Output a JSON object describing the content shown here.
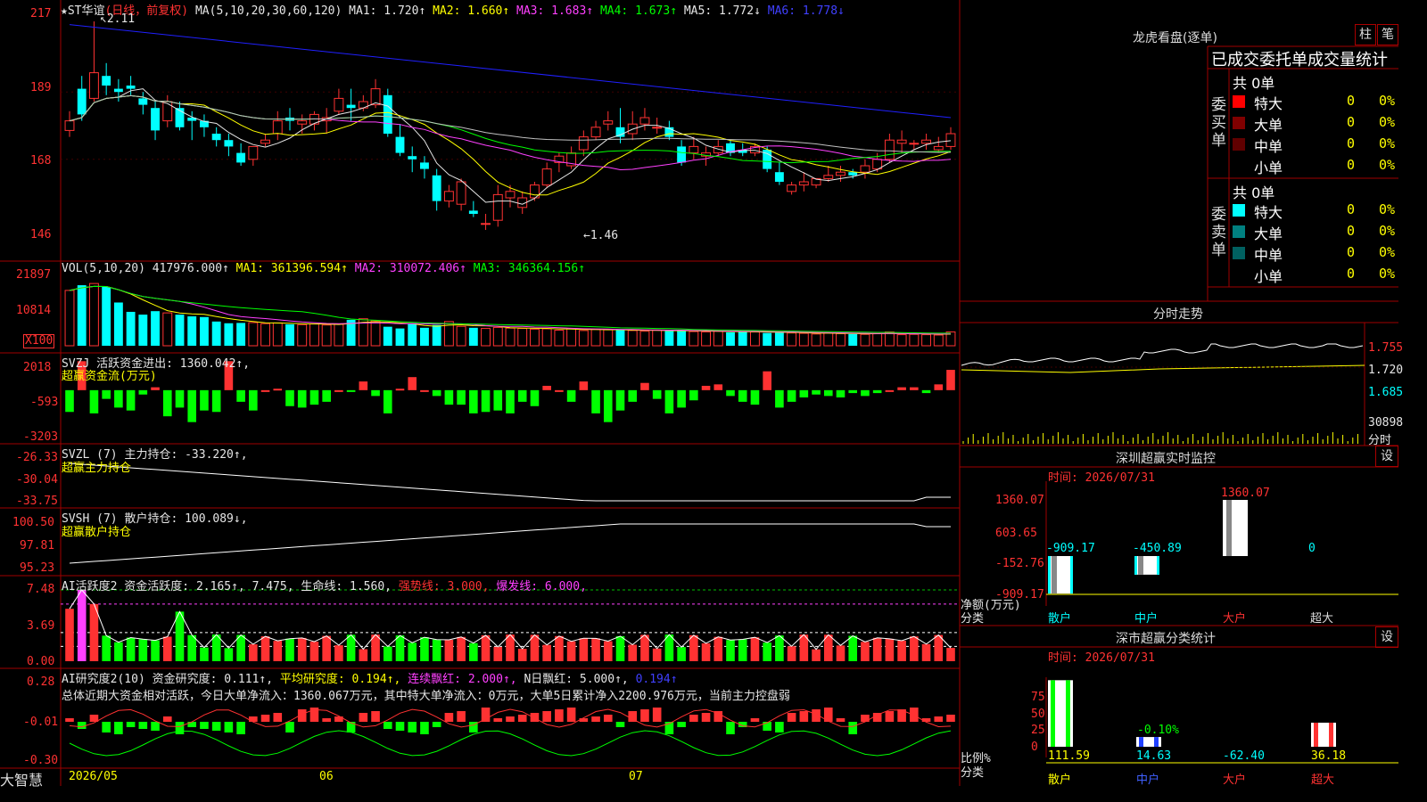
{
  "colors": {
    "up": "#ff3232",
    "down": "#00ffff",
    "grid": "#a00000",
    "ma1": "#e6e6e6",
    "ma2": "#ffff00",
    "ma3": "#ff40ff",
    "ma4": "#00ff00",
    "ma5": "#c0c0c0",
    "ma6": "#2020ff"
  },
  "header": {
    "star": "★ST华谊",
    "period": "(日线，前复权)",
    "ma_label": "MA(5,10,20,30,60,120)",
    "ma1": "MA1: 1.720↑",
    "ma2": "MA2: 1.660↑",
    "ma3": "MA3: 1.683↑",
    "ma4": "MA4: 1.673↑",
    "ma5": "MA5: 1.772↓",
    "ma6": "MA6: 1.778↓"
  },
  "price_axis": [
    "217",
    "189",
    "168",
    "146"
  ],
  "price_marks": {
    "high": "2.11",
    "low": "1.46"
  },
  "vol": {
    "label": "VOL(5,10,20)",
    "value": "417976.000↑",
    "ma1": "MA1: 361396.594↑",
    "ma2": "MA2: 310072.406↑",
    "ma3": "MA3: 346364.156↑",
    "axis": [
      "21897",
      "10814"
    ],
    "unit": "X100"
  },
  "svzj": {
    "label": "SVZJ  活跃资金进出: 1360.042↑,",
    "sub": "超赢资金流(万元)",
    "axis": [
      "2018",
      "-593",
      "-3203"
    ]
  },
  "svzl": {
    "label": "SVZL (7) 主力持仓: -33.220↑,",
    "sub": "超赢主力持仓",
    "axis": [
      "-26.33",
      "-30.04",
      "-33.75"
    ]
  },
  "svsh": {
    "label": "SVSH (7) 散户持仓: 100.089↓,",
    "sub": "超赢散户持仓",
    "axis": [
      "100.50",
      "97.81",
      "95.23"
    ]
  },
  "ai1": {
    "label": "AI活跃度2 资金活跃度: 2.165↑, 7.475,",
    "life": "生命线: 1.560,",
    "strong": "强势线: 3.000,",
    "burst": "爆发线: 6.000,",
    "axis": [
      "7.48",
      "3.69",
      "0.00"
    ]
  },
  "ai2": {
    "label": "AI研究度2(10) 资金研究度: 0.111↑,",
    "avg": "平均研究度: 0.194↑,",
    "cont": "连续飘红: 2.000↑,",
    "nday": "N日飘红: 5.000↑,",
    "last": "0.194↑",
    "summary": "总体近期大资金相对活跃，今日大单净流入：1360.067万元，其中特大单净流入：0万元，大单5日累计净入2200.976万元，当前主力控盘弱",
    "axis": [
      "0.28",
      "-0.01",
      "-0.30"
    ]
  },
  "xaxis": [
    "2026/05",
    "06",
    "07"
  ],
  "logo": "大智慧",
  "right": {
    "title": "龙虎看盘(逐单)",
    "btn1": "柱",
    "btn2": "笔",
    "stat_title": "已成交委托单成交量统计",
    "buy": {
      "side": "委买单",
      "total": "共 0单",
      "rows": [
        {
          "name": "特大",
          "v": "0",
          "p": "0%"
        },
        {
          "name": "大单",
          "v": "0",
          "p": "0%"
        },
        {
          "name": "中单",
          "v": "0",
          "p": "0%"
        },
        {
          "name": "小单",
          "v": "0",
          "p": "0%"
        }
      ]
    },
    "sell": {
      "side": "委卖单",
      "total": "共 0单",
      "rows": [
        {
          "name": "特大",
          "v": "0",
          "p": "0%"
        },
        {
          "name": "大单",
          "v": "0",
          "p": "0%"
        },
        {
          "name": "中单",
          "v": "0",
          "p": "0%"
        },
        {
          "name": "小单",
          "v": "0",
          "p": "0%"
        }
      ]
    },
    "intraday": {
      "title": "分时走势",
      "axis": [
        "1.755",
        "1.720",
        "1.685"
      ],
      "vol": "30898",
      "vol2": "分时"
    },
    "monitor": {
      "title": "深圳超赢实时监控",
      "btn": "设",
      "time": "时间: 2026/07/31",
      "axis": [
        "1360.07",
        "603.65",
        "-152.76",
        "-909.17"
      ],
      "ylabel": "净额(万元)",
      "xlabel": "分类",
      "cats": [
        "散户",
        "中户",
        "大户",
        "超大"
      ],
      "vals": [
        "-909.17",
        "-450.89",
        "1360.07",
        "0"
      ]
    },
    "classify": {
      "title": "深市超赢分类统计",
      "btn": "设",
      "time": "时间: 2026/07/31",
      "axis": [
        "75",
        "50",
        "25",
        "0"
      ],
      "ylabel": "比例%",
      "xlabel": "分类",
      "cats": [
        "散户",
        "中户",
        "大户",
        "超大"
      ],
      "vals": [
        "111.59",
        "14.63",
        "-62.40",
        "36.18"
      ],
      "note": "-0.10%"
    }
  },
  "chart_data": {
    "type": "candlestick",
    "title": "★ST华谊 (日线，前复权)",
    "x_ticks": [
      "2026/05",
      "06",
      "07"
    ],
    "ohlc": [
      [
        1.77,
        1.83,
        1.75,
        1.8
      ],
      [
        1.9,
        1.94,
        1.8,
        1.82
      ],
      [
        1.87,
        2.11,
        1.86,
        1.95
      ],
      [
        1.94,
        1.98,
        1.88,
        1.91
      ],
      [
        1.9,
        1.93,
        1.86,
        1.89
      ],
      [
        1.91,
        1.94,
        1.88,
        1.9
      ],
      [
        1.87,
        1.89,
        1.82,
        1.85
      ],
      [
        1.84,
        1.86,
        1.74,
        1.77
      ],
      [
        1.8,
        1.88,
        1.78,
        1.86
      ],
      [
        1.84,
        1.86,
        1.77,
        1.78
      ],
      [
        1.81,
        1.83,
        1.74,
        1.8
      ],
      [
        1.8,
        1.82,
        1.75,
        1.78
      ],
      [
        1.76,
        1.78,
        1.72,
        1.74
      ],
      [
        1.74,
        1.76,
        1.69,
        1.72
      ],
      [
        1.7,
        1.73,
        1.66,
        1.67
      ],
      [
        1.68,
        1.72,
        1.66,
        1.72
      ],
      [
        1.73,
        1.76,
        1.72,
        1.74
      ],
      [
        1.76,
        1.83,
        1.74,
        1.8
      ],
      [
        1.81,
        1.84,
        1.77,
        1.8
      ],
      [
        1.79,
        1.82,
        1.76,
        1.8
      ],
      [
        1.79,
        1.83,
        1.77,
        1.82
      ],
      [
        1.8,
        1.84,
        1.76,
        1.81
      ],
      [
        1.83,
        1.9,
        1.82,
        1.87
      ],
      [
        1.85,
        1.9,
        1.8,
        1.84
      ],
      [
        1.84,
        1.88,
        1.83,
        1.86
      ],
      [
        1.85,
        1.93,
        1.84,
        1.9
      ],
      [
        1.88,
        1.9,
        1.75,
        1.76
      ],
      [
        1.75,
        1.79,
        1.69,
        1.7
      ],
      [
        1.69,
        1.72,
        1.64,
        1.68
      ],
      [
        1.67,
        1.69,
        1.62,
        1.65
      ],
      [
        1.63,
        1.65,
        1.52,
        1.55
      ],
      [
        1.55,
        1.6,
        1.53,
        1.58
      ],
      [
        1.54,
        1.62,
        1.52,
        1.61
      ],
      [
        1.52,
        1.55,
        1.5,
        1.51
      ],
      [
        1.48,
        1.51,
        1.46,
        1.48
      ],
      [
        1.49,
        1.6,
        1.47,
        1.57
      ],
      [
        1.56,
        1.6,
        1.53,
        1.58
      ],
      [
        1.53,
        1.58,
        1.51,
        1.56
      ],
      [
        1.56,
        1.61,
        1.55,
        1.6
      ],
      [
        1.6,
        1.67,
        1.59,
        1.65
      ],
      [
        1.67,
        1.7,
        1.64,
        1.69
      ],
      [
        1.66,
        1.72,
        1.65,
        1.7
      ],
      [
        1.71,
        1.77,
        1.69,
        1.75
      ],
      [
        1.75,
        1.8,
        1.74,
        1.78
      ],
      [
        1.79,
        1.83,
        1.77,
        1.8
      ],
      [
        1.78,
        1.84,
        1.73,
        1.75
      ],
      [
        1.76,
        1.83,
        1.74,
        1.79
      ],
      [
        1.79,
        1.84,
        1.77,
        1.81
      ],
      [
        1.78,
        1.81,
        1.76,
        1.78
      ],
      [
        1.78,
        1.8,
        1.74,
        1.75
      ],
      [
        1.72,
        1.74,
        1.66,
        1.67
      ],
      [
        1.7,
        1.75,
        1.68,
        1.72
      ],
      [
        1.69,
        1.72,
        1.66,
        1.7
      ],
      [
        1.7,
        1.74,
        1.69,
        1.72
      ],
      [
        1.73,
        1.74,
        1.69,
        1.7
      ],
      [
        1.71,
        1.73,
        1.69,
        1.7
      ],
      [
        1.7,
        1.73,
        1.69,
        1.72
      ],
      [
        1.71,
        1.72,
        1.64,
        1.65
      ],
      [
        1.64,
        1.67,
        1.6,
        1.61
      ],
      [
        1.58,
        1.61,
        1.57,
        1.6
      ],
      [
        1.6,
        1.64,
        1.58,
        1.61
      ],
      [
        1.6,
        1.62,
        1.59,
        1.62
      ],
      [
        1.62,
        1.66,
        1.61,
        1.63
      ],
      [
        1.63,
        1.66,
        1.61,
        1.64
      ],
      [
        1.64,
        1.65,
        1.62,
        1.63
      ],
      [
        1.64,
        1.68,
        1.62,
        1.66
      ],
      [
        1.65,
        1.7,
        1.64,
        1.68
      ],
      [
        1.68,
        1.76,
        1.67,
        1.74
      ],
      [
        1.73,
        1.77,
        1.7,
        1.74
      ],
      [
        1.73,
        1.74,
        1.71,
        1.73
      ],
      [
        1.73,
        1.76,
        1.71,
        1.74
      ],
      [
        1.71,
        1.75,
        1.7,
        1.72
      ],
      [
        1.72,
        1.78,
        1.71,
        1.76
      ]
    ],
    "volume": [
      16000,
      17500,
      18000,
      17000,
      12500,
      9800,
      9000,
      10000,
      9500,
      9000,
      8500,
      8300,
      7000,
      6500,
      6600,
      6700,
      6400,
      6600,
      6200,
      6100,
      6300,
      6000,
      6200,
      7500,
      7800,
      7200,
      5500,
      5000,
      6500,
      5200,
      6000,
      7000,
      5600,
      5200,
      5000,
      5300,
      5100,
      5000,
      4800,
      4900,
      4500,
      5000,
      4400,
      4700,
      4600,
      4500,
      4400,
      4200,
      4500,
      4300,
      4400,
      4100,
      4000,
      4200,
      3900,
      4100,
      4000,
      3700,
      3800,
      3700,
      3600,
      3400,
      3700,
      3500,
      3400,
      3300,
      3500,
      4000,
      3200,
      3300,
      3200,
      3100,
      4000
    ],
    "svzj_values": [
      -1.5,
      2.0,
      -1.6,
      -0.6,
      -1.2,
      -1.4,
      -0.3,
      0.2,
      -1.8,
      -1.2,
      -2.2,
      -1.4,
      -1.5,
      2.0,
      -0.8,
      -1.4,
      0.0,
      0.1,
      -1.1,
      -1.2,
      -1.0,
      -0.8,
      0.0,
      -0.1,
      0.6,
      -0.4,
      -1.6,
      0.1,
      0.9,
      0.0,
      -0.4,
      -1.0,
      -1.0,
      -1.6,
      -1.5,
      -1.4,
      -1.6,
      -0.8,
      -1.1,
      0.3,
      0.0,
      -0.8,
      0.6,
      -1.6,
      -2.2,
      -1.4,
      -0.8,
      0.5,
      -0.6,
      -1.6,
      -1.2,
      -0.7,
      0.3,
      0.4,
      -0.4,
      -0.8,
      -1.0,
      1.3,
      -1.2,
      -0.8,
      -0.5,
      -0.3,
      -0.4,
      -0.5,
      -0.2,
      -0.4,
      -0.2,
      0.0,
      0.2,
      0.2,
      -0.2,
      0.4,
      1.4
    ]
  }
}
